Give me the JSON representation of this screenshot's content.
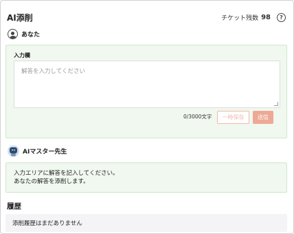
{
  "header": {
    "title": "AI添削",
    "ticket_label": "チケット残数",
    "ticket_count": "98",
    "help_icon": "question-circle-icon"
  },
  "user": {
    "name": "あなた",
    "icon": "user-circle-icon"
  },
  "input": {
    "label": "入力欄",
    "placeholder": "解答を入力してください",
    "value": "",
    "char_count": "0/3000文字",
    "save_button": "一時保存",
    "send_button": "送信"
  },
  "teacher": {
    "name": "AIマスター先生",
    "icon": "robot-avatar-icon"
  },
  "message": {
    "line1": "入力エリアに解答を記入してください。",
    "line2": "あなたの解答を添削します。"
  },
  "history": {
    "title": "履歴",
    "empty_text": "添削履歴はまだありません"
  },
  "colors": {
    "panel_bg": "#f0f8ef",
    "panel_border": "#cfe6cc",
    "accent": "#eda995",
    "accent_light": "#f1b8aa",
    "history_bg": "#f4f4f6"
  }
}
